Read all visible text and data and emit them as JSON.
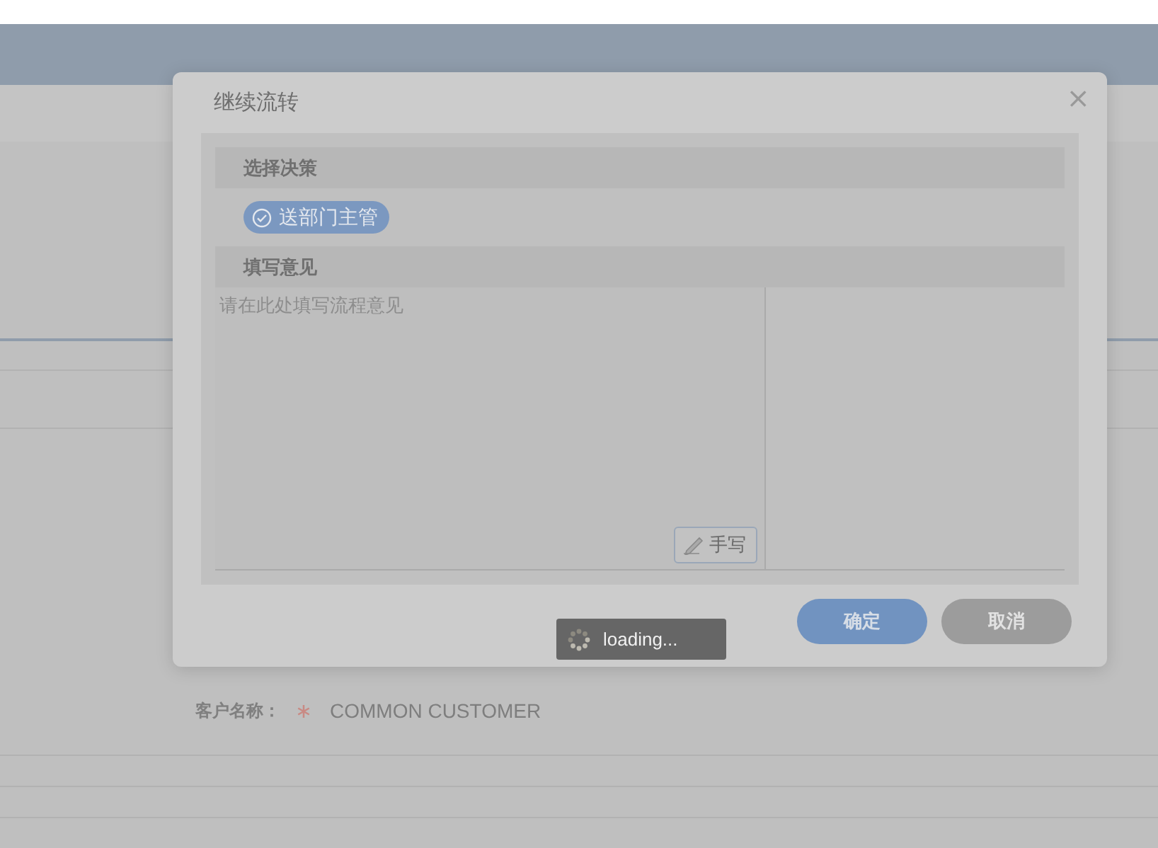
{
  "page": {
    "field": {
      "label": "客户名称：",
      "required": true,
      "value": "COMMON CUSTOMER"
    }
  },
  "dialog": {
    "title": "继续流转",
    "close": "×",
    "sections": [
      {
        "kind": "choices",
        "title": "选择决策",
        "options": [
          {
            "label": "送部门主管",
            "selected": true
          }
        ]
      },
      {
        "kind": "comment",
        "title": "填写意见",
        "placeholder": "请在此处填写流程意见",
        "handwrite": "手写"
      }
    ],
    "buttons": [
      {
        "label": "确定",
        "kind": "primary"
      },
      {
        "label": "取消",
        "kind": "secondary"
      }
    ]
  },
  "toast": {
    "text": "loading..."
  }
}
